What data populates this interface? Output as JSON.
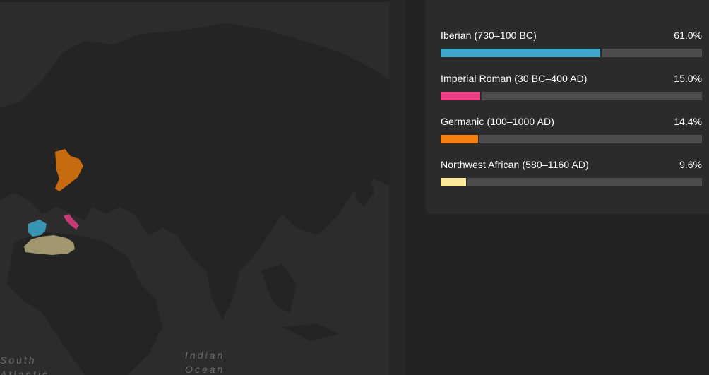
{
  "map": {
    "ocean_labels": {
      "indian": [
        "Indian",
        "Ocean"
      ],
      "south_atlantic": [
        "South",
        "Atlantic"
      ]
    },
    "colors": {
      "background": "#2c2c2c",
      "land": "#242424",
      "iberian": "#3ba8cc",
      "imperial_roman": "#e23d82",
      "germanic": "#f07d0c",
      "northwest_african": "#d6c98f"
    }
  },
  "ancestry": {
    "populations": [
      {
        "name": "Iberian (730–100 BC)",
        "percent_label": "61.0%",
        "percent": 61.0,
        "color": "#3da8cb"
      },
      {
        "name": "Imperial Roman (30 BC–400 AD)",
        "percent_label": "15.0%",
        "percent": 15.0,
        "color": "#ef3f86"
      },
      {
        "name": "Germanic (100–1000 AD)",
        "percent_label": "14.4%",
        "percent": 14.4,
        "color": "#f57f0f"
      },
      {
        "name": "Northwest African (580–1160 AD)",
        "percent_label": "9.6%",
        "percent": 9.6,
        "color": "#fbe99c"
      }
    ]
  }
}
